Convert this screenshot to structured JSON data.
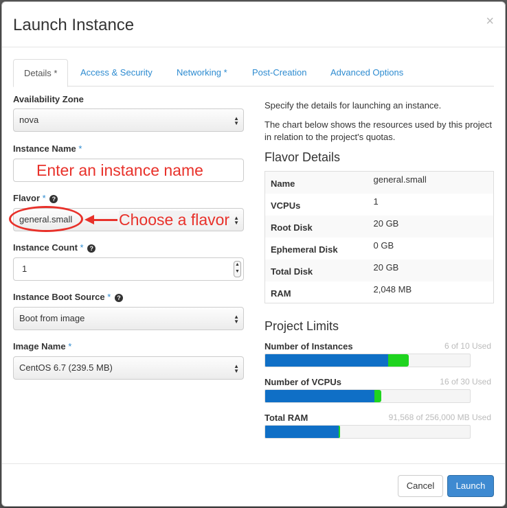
{
  "dialog": {
    "title": "Launch Instance",
    "close_glyph": "×"
  },
  "tabs": [
    {
      "label": "Details *",
      "active": true
    },
    {
      "label": "Access & Security",
      "active": false
    },
    {
      "label": "Networking *",
      "active": false
    },
    {
      "label": "Post-Creation",
      "active": false
    },
    {
      "label": "Advanced Options",
      "active": false
    }
  ],
  "form": {
    "availability_zone": {
      "label": "Availability Zone",
      "value": "nova"
    },
    "instance_name": {
      "label": "Instance Name",
      "required": "*",
      "value": ""
    },
    "flavor": {
      "label": "Flavor",
      "required": "*",
      "value": "general.small"
    },
    "instance_count": {
      "label": "Instance Count",
      "required": "*",
      "value": "1"
    },
    "boot_source": {
      "label": "Instance Boot Source",
      "required": "*",
      "value": "Boot from image"
    },
    "image_name": {
      "label": "Image Name",
      "required": "*",
      "value": "CentOS 6.7 (239.5 MB)"
    }
  },
  "annotations": {
    "instance_name": "Enter an instance name",
    "flavor": "Choose a flavor"
  },
  "info": {
    "desc1": "Specify the details for launching an instance.",
    "desc2": "The chart below shows the resources used by this project in relation to the project's quotas."
  },
  "flavor_details": {
    "title": "Flavor Details",
    "rows": [
      {
        "key": "Name",
        "value": "general.small"
      },
      {
        "key": "VCPUs",
        "value": "1"
      },
      {
        "key": "Root Disk",
        "value": "20 GB"
      },
      {
        "key": "Ephemeral Disk",
        "value": "0 GB"
      },
      {
        "key": "Total Disk",
        "value": "20 GB"
      },
      {
        "key": "RAM",
        "value": "2,048 MB"
      }
    ]
  },
  "project_limits": {
    "title": "Project Limits",
    "items": [
      {
        "label": "Number of Instances",
        "used_text": "6 of 10 Used",
        "used_fraction": 0.6,
        "added_fraction": 0.1
      },
      {
        "label": "Number of VCPUs",
        "used_text": "16 of 30 Used",
        "used_fraction": 0.533,
        "added_fraction": 0.033
      },
      {
        "label": "Total RAM",
        "used_text": "91,568 of 256,000 MB Used",
        "used_fraction": 0.358,
        "added_fraction": 0.008
      }
    ]
  },
  "footer": {
    "cancel_label": "Cancel",
    "launch_label": "Launch"
  },
  "colors": {
    "link": "#2d8bd0",
    "annotation": "#e8312a",
    "bar_used": "#0f6fc6",
    "bar_added": "#1fd41f",
    "primary_button": "#3e8ad1"
  },
  "icons": {
    "help": "question-circle-icon",
    "select_arrows": "sort-arrows-icon",
    "stepper": "spinner-arrows-icon"
  }
}
